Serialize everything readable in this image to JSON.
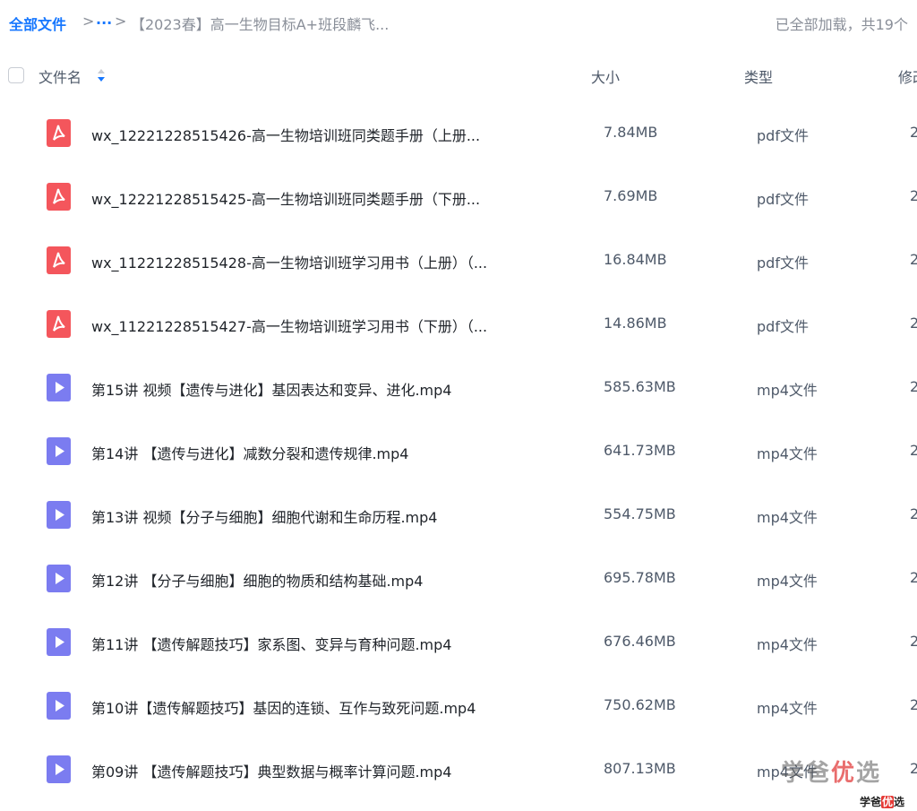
{
  "breadcrumb": {
    "root": "全部文件",
    "separator": ">",
    "ellipsis": "...",
    "folder": "【2023春】高一生物目标A+班段麟飞..."
  },
  "load_status": "已全部加载，共19个",
  "columns": {
    "name": "文件名",
    "size": "大小",
    "type": "类型",
    "modified": "修改"
  },
  "colors": {
    "accent": "#1677ff",
    "pdf_icon": "#f4565c",
    "video_icon": "#7b7cf0"
  },
  "files": [
    {
      "icon": "pdf-icon",
      "name": "wx_12221228515426-高一生物培训班同类题手册（上册...",
      "size": "7.84MB",
      "type": "pdf文件",
      "modified": "2"
    },
    {
      "icon": "pdf-icon",
      "name": "wx_12221228515425-高一生物培训班同类题手册（下册...",
      "size": "7.69MB",
      "type": "pdf文件",
      "modified": "2"
    },
    {
      "icon": "pdf-icon",
      "name": "wx_11221228515428-高一生物培训班学习用书（上册）（...",
      "size": "16.84MB",
      "type": "pdf文件",
      "modified": "2"
    },
    {
      "icon": "pdf-icon",
      "name": "wx_11221228515427-高一生物培训班学习用书（下册）（...",
      "size": "14.86MB",
      "type": "pdf文件",
      "modified": "2"
    },
    {
      "icon": "video-icon",
      "name": "第15讲 视频【遗传与进化】基因表达和变异、进化.mp4",
      "size": "585.63MB",
      "type": "mp4文件",
      "modified": "2"
    },
    {
      "icon": "video-icon",
      "name": "第14讲 【遗传与进化】减数分裂和遗传规律.mp4",
      "size": "641.73MB",
      "type": "mp4文件",
      "modified": "2"
    },
    {
      "icon": "video-icon",
      "name": "第13讲 视频【分子与细胞】细胞代谢和生命历程.mp4",
      "size": "554.75MB",
      "type": "mp4文件",
      "modified": "2"
    },
    {
      "icon": "video-icon",
      "name": "第12讲 【分子与细胞】细胞的物质和结构基础.mp4",
      "size": "695.78MB",
      "type": "mp4文件",
      "modified": "2"
    },
    {
      "icon": "video-icon",
      "name": "第11讲 【遗传解题技巧】家系图、变异与育种问题.mp4",
      "size": "676.46MB",
      "type": "mp4文件",
      "modified": "2"
    },
    {
      "icon": "video-icon",
      "name": "第10讲【遗传解题技巧】基因的连锁、互作与致死问题.mp4",
      "size": "750.62MB",
      "type": "mp4文件",
      "modified": "2"
    },
    {
      "icon": "video-icon",
      "name": "第09讲 【遗传解题技巧】典型数据与概率计算问题.mp4",
      "size": "807.13MB",
      "type": "mp4文件",
      "modified": "2"
    }
  ],
  "watermark": {
    "large_a": "学爸",
    "large_b": "优",
    "large_c": "选",
    "small_a": "学爸",
    "small_b": "优",
    "small_c": "选"
  }
}
